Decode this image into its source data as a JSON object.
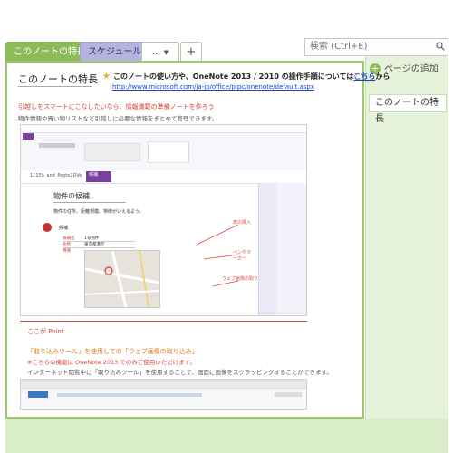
{
  "tabs": [
    {
      "label": "このノートの特長",
      "active": true
    },
    {
      "label": "スケジュール",
      "active": false
    }
  ],
  "tab_more_label": "...",
  "tab_add_label": "+",
  "search": {
    "placeholder": "検索 (Ctrl+E)"
  },
  "sidebar": {
    "add_page_label": "ページの追加",
    "pages": [
      "このノートの特長"
    ]
  },
  "page": {
    "title": "このノートの特長",
    "note_text": "このノートの使い方や、OneNote 2013 / 2010 の操作手順については",
    "note_link": "こちら",
    "note_suffix": "から",
    "url": "http://www.microsoft.com/ja-jp/office/pipc/onenote/default.aspx",
    "heading1": "引越しをスマートにこなしたいなら、情報満載の準備ノートを作ろう",
    "body1": "物件情報や買い物リストなど引越しに必要な情報をまとめて管理できます。",
    "screenshot": {
      "doc_title": "物件の候補",
      "doc_sub": "物件の住所、距離規模、特徴がいえるよう。",
      "tab_label": "11155_and_Pooto2DVe",
      "table_rows": [
        {
          "key": "候補名",
          "value": "1号物件"
        },
        {
          "key": "住所",
          "value": "東京都港区"
        },
        {
          "key": "特徴",
          "value": ""
        }
      ],
      "annotations": [
        "表の挿入",
        "ペンやマーカー",
        "ウェブ画像の取り込み"
      ],
      "section_label": "候補"
    },
    "point_heading": "ここが Point",
    "point_line1": "「取り込みツール」を使用しての「ウェブ画像の取り込み」",
    "point_line2": "※こちらの機能は OneNote 2013 でのみご使用いただけます。",
    "point_body": "インターネット閲覧中に「取り込みツール」を使用することで、画面に画像をスクラッピングすることができます。"
  },
  "colors": {
    "accent_green": "#8dbb5a",
    "tab2_purple": "#b7b3e0",
    "heading_red": "#d8453b",
    "link_blue": "#1a44c8"
  }
}
